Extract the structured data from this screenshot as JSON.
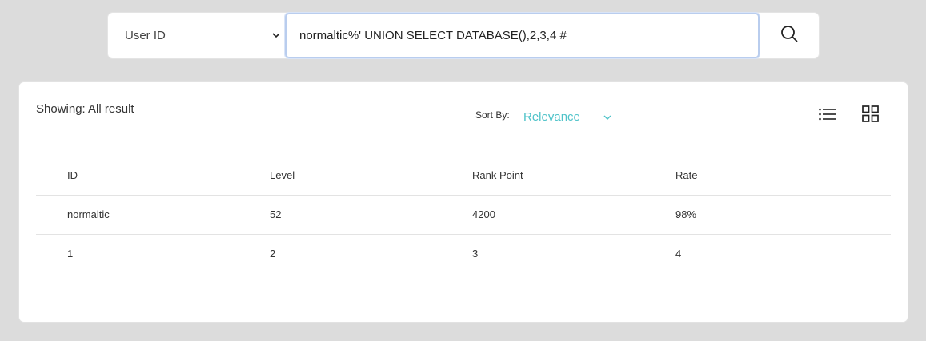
{
  "search": {
    "filter_value": "User ID",
    "query": "normaltic%' UNION SELECT DATABASE(),2,3,4 #",
    "search_icon": "search-icon"
  },
  "results": {
    "showing_text": "Showing: All result",
    "sort_label": "Sort By:",
    "sort_value": "Relevance",
    "view_icons": [
      "list-view-icon",
      "grid-view-icon"
    ],
    "columns": [
      "ID",
      "Level",
      "Rank Point",
      "Rate"
    ],
    "rows": [
      [
        "normaltic",
        "52",
        "4200",
        "98%"
      ],
      [
        "1",
        "2",
        "3",
        "4"
      ]
    ]
  },
  "colors": {
    "accent": "#4fc3c9",
    "input_focus_border": "#b9cdee",
    "background": "#dcdcdc"
  }
}
